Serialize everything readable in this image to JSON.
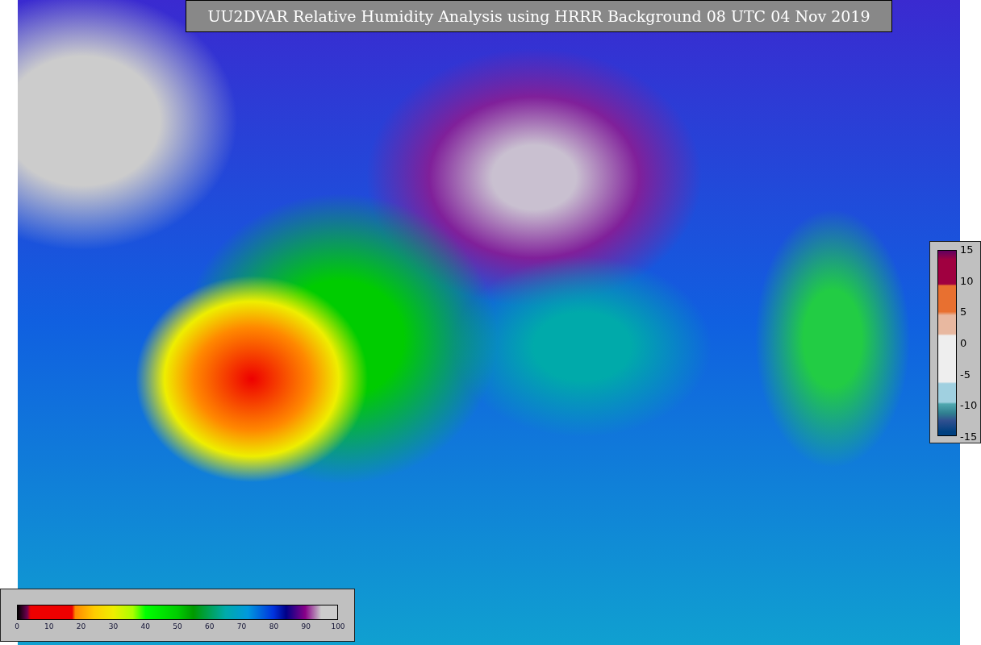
{
  "title": "UU2DVAR Relative Humidity Analysis using HRRR Background 08 UTC 04 Nov 2019",
  "colorbar_bottom": {
    "ticks": [
      "0",
      "10",
      "20",
      "30",
      "40",
      "50",
      "60",
      "70",
      "80",
      "90",
      "100"
    ]
  },
  "colorbar_right": {
    "ticks": [
      "15",
      "10",
      "5",
      "0",
      "-5",
      "-10",
      "-15"
    ]
  }
}
